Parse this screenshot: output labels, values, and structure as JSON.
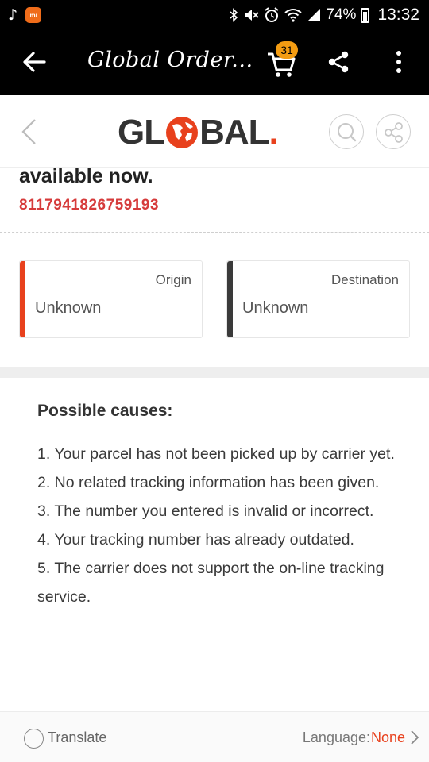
{
  "status_bar": {
    "battery": "74%",
    "time": "13:32",
    "mi_label": "mi"
  },
  "app_bar": {
    "title": "Global Order...",
    "cart_count": "31"
  },
  "site_header": {
    "logo_left": "GL",
    "logo_right": "BAL",
    "logo_dot": ".",
    "brand_color": "#e8411d"
  },
  "result": {
    "title": "available now.",
    "tracking_number": "8117941826759193"
  },
  "route": {
    "origin_label": "Origin",
    "origin_value": "Unknown",
    "destination_label": "Destination",
    "destination_value": "Unknown"
  },
  "causes": {
    "title": "Possible causes:",
    "items": [
      "1. Your parcel has not been picked up by carrier yet.",
      "2. No related tracking information has been given.",
      "3. The number you entered is invalid or incorrect.",
      "4. Your tracking number has already outdated.",
      "5. The carrier does not support the on-line tracking service."
    ]
  },
  "bottom_bar": {
    "translate_label": "Translate",
    "language_label": "Language:",
    "language_value": "None"
  }
}
